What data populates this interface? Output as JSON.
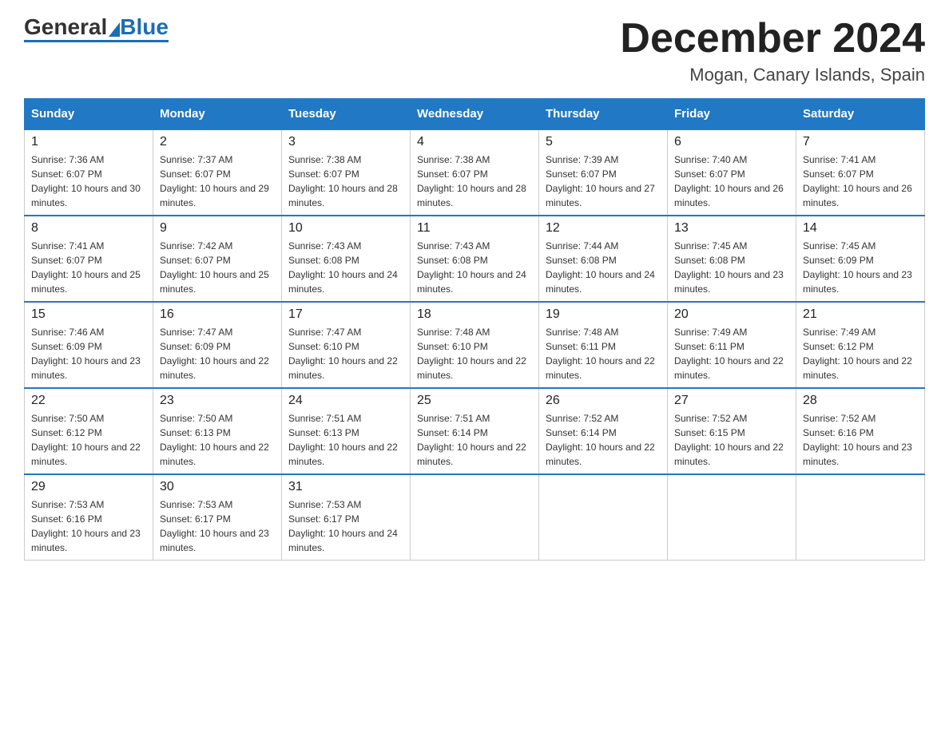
{
  "logo": {
    "general": "General",
    "blue": "Blue"
  },
  "header": {
    "month": "December 2024",
    "location": "Mogan, Canary Islands, Spain"
  },
  "weekdays": [
    "Sunday",
    "Monday",
    "Tuesday",
    "Wednesday",
    "Thursday",
    "Friday",
    "Saturday"
  ],
  "weeks": [
    [
      {
        "day": "1",
        "sunrise": "7:36 AM",
        "sunset": "6:07 PM",
        "daylight": "10 hours and 30 minutes."
      },
      {
        "day": "2",
        "sunrise": "7:37 AM",
        "sunset": "6:07 PM",
        "daylight": "10 hours and 29 minutes."
      },
      {
        "day": "3",
        "sunrise": "7:38 AM",
        "sunset": "6:07 PM",
        "daylight": "10 hours and 28 minutes."
      },
      {
        "day": "4",
        "sunrise": "7:38 AM",
        "sunset": "6:07 PM",
        "daylight": "10 hours and 28 minutes."
      },
      {
        "day": "5",
        "sunrise": "7:39 AM",
        "sunset": "6:07 PM",
        "daylight": "10 hours and 27 minutes."
      },
      {
        "day": "6",
        "sunrise": "7:40 AM",
        "sunset": "6:07 PM",
        "daylight": "10 hours and 26 minutes."
      },
      {
        "day": "7",
        "sunrise": "7:41 AM",
        "sunset": "6:07 PM",
        "daylight": "10 hours and 26 minutes."
      }
    ],
    [
      {
        "day": "8",
        "sunrise": "7:41 AM",
        "sunset": "6:07 PM",
        "daylight": "10 hours and 25 minutes."
      },
      {
        "day": "9",
        "sunrise": "7:42 AM",
        "sunset": "6:07 PM",
        "daylight": "10 hours and 25 minutes."
      },
      {
        "day": "10",
        "sunrise": "7:43 AM",
        "sunset": "6:08 PM",
        "daylight": "10 hours and 24 minutes."
      },
      {
        "day": "11",
        "sunrise": "7:43 AM",
        "sunset": "6:08 PM",
        "daylight": "10 hours and 24 minutes."
      },
      {
        "day": "12",
        "sunrise": "7:44 AM",
        "sunset": "6:08 PM",
        "daylight": "10 hours and 24 minutes."
      },
      {
        "day": "13",
        "sunrise": "7:45 AM",
        "sunset": "6:08 PM",
        "daylight": "10 hours and 23 minutes."
      },
      {
        "day": "14",
        "sunrise": "7:45 AM",
        "sunset": "6:09 PM",
        "daylight": "10 hours and 23 minutes."
      }
    ],
    [
      {
        "day": "15",
        "sunrise": "7:46 AM",
        "sunset": "6:09 PM",
        "daylight": "10 hours and 23 minutes."
      },
      {
        "day": "16",
        "sunrise": "7:47 AM",
        "sunset": "6:09 PM",
        "daylight": "10 hours and 22 minutes."
      },
      {
        "day": "17",
        "sunrise": "7:47 AM",
        "sunset": "6:10 PM",
        "daylight": "10 hours and 22 minutes."
      },
      {
        "day": "18",
        "sunrise": "7:48 AM",
        "sunset": "6:10 PM",
        "daylight": "10 hours and 22 minutes."
      },
      {
        "day": "19",
        "sunrise": "7:48 AM",
        "sunset": "6:11 PM",
        "daylight": "10 hours and 22 minutes."
      },
      {
        "day": "20",
        "sunrise": "7:49 AM",
        "sunset": "6:11 PM",
        "daylight": "10 hours and 22 minutes."
      },
      {
        "day": "21",
        "sunrise": "7:49 AM",
        "sunset": "6:12 PM",
        "daylight": "10 hours and 22 minutes."
      }
    ],
    [
      {
        "day": "22",
        "sunrise": "7:50 AM",
        "sunset": "6:12 PM",
        "daylight": "10 hours and 22 minutes."
      },
      {
        "day": "23",
        "sunrise": "7:50 AM",
        "sunset": "6:13 PM",
        "daylight": "10 hours and 22 minutes."
      },
      {
        "day": "24",
        "sunrise": "7:51 AM",
        "sunset": "6:13 PM",
        "daylight": "10 hours and 22 minutes."
      },
      {
        "day": "25",
        "sunrise": "7:51 AM",
        "sunset": "6:14 PM",
        "daylight": "10 hours and 22 minutes."
      },
      {
        "day": "26",
        "sunrise": "7:52 AM",
        "sunset": "6:14 PM",
        "daylight": "10 hours and 22 minutes."
      },
      {
        "day": "27",
        "sunrise": "7:52 AM",
        "sunset": "6:15 PM",
        "daylight": "10 hours and 22 minutes."
      },
      {
        "day": "28",
        "sunrise": "7:52 AM",
        "sunset": "6:16 PM",
        "daylight": "10 hours and 23 minutes."
      }
    ],
    [
      {
        "day": "29",
        "sunrise": "7:53 AM",
        "sunset": "6:16 PM",
        "daylight": "10 hours and 23 minutes."
      },
      {
        "day": "30",
        "sunrise": "7:53 AM",
        "sunset": "6:17 PM",
        "daylight": "10 hours and 23 minutes."
      },
      {
        "day": "31",
        "sunrise": "7:53 AM",
        "sunset": "6:17 PM",
        "daylight": "10 hours and 24 minutes."
      },
      null,
      null,
      null,
      null
    ]
  ],
  "labels": {
    "sunrise": "Sunrise:",
    "sunset": "Sunset:",
    "daylight": "Daylight:"
  }
}
